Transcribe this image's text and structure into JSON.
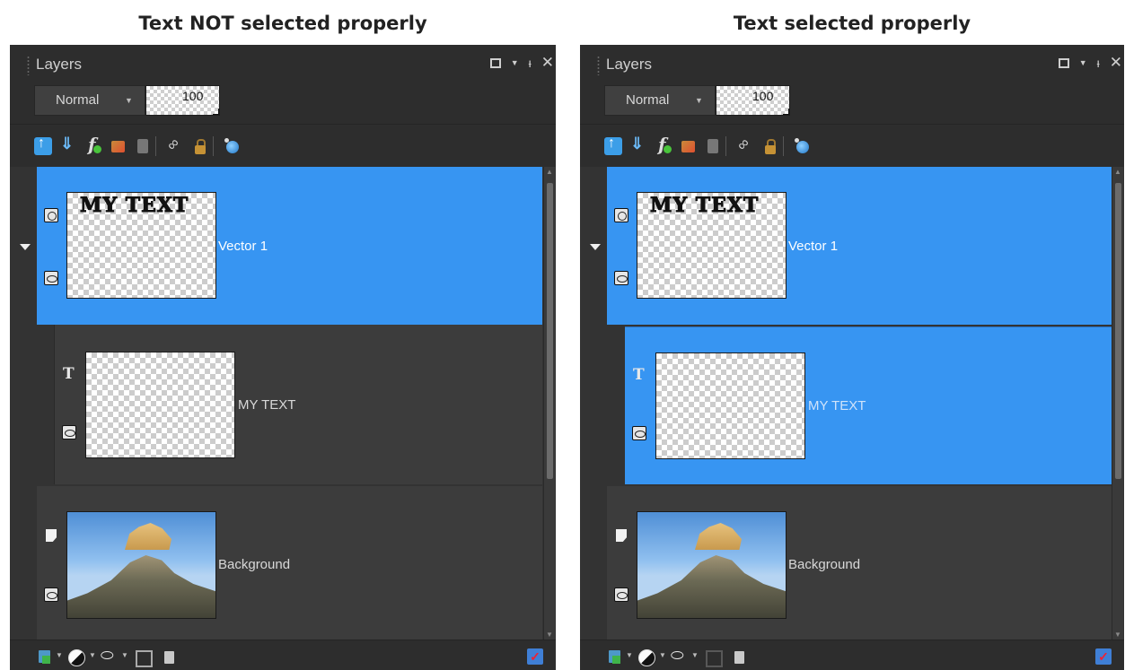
{
  "captions": {
    "left": "Text NOT selected properly",
    "right": "Text selected properly"
  },
  "panel": {
    "title": "Layers",
    "blend_mode": "Normal",
    "opacity": "100",
    "window_buttons": [
      "maximize-icon",
      "dropdown-icon",
      "pin-icon",
      "close-icon"
    ],
    "toolbar_icons": [
      "move-layer-up-icon",
      "move-layer-down-icon",
      "layer-effects-icon",
      "layer-styles-icon",
      "adjustment-icon",
      "link-icon",
      "lock-icon",
      "visibility-toggle-icon"
    ],
    "bottom_icons": [
      "new-layer-icon",
      "new-adjustment-layer-icon",
      "new-mask-icon",
      "delete-mask-icon",
      "delete-layer-icon",
      "apply-changes-icon"
    ]
  },
  "layers": [
    {
      "name": "Vector 1",
      "type": "vector",
      "thumb_text": "MY TEXT"
    },
    {
      "name": "MY TEXT",
      "type": "text"
    },
    {
      "name": "Background",
      "type": "raster"
    }
  ],
  "colors": {
    "selected": "#3795f2",
    "panel_bg": "#333333",
    "header_bg": "#2d2d2d"
  }
}
